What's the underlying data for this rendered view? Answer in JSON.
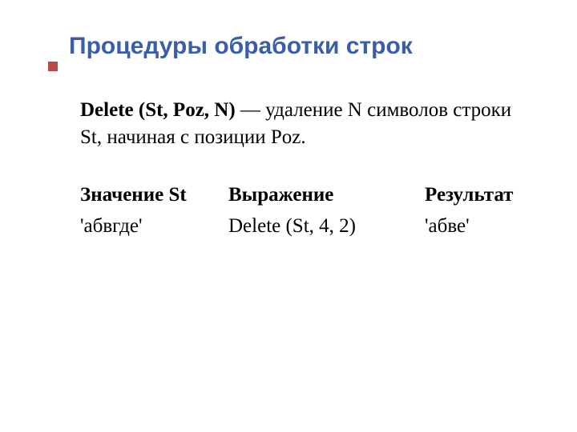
{
  "title": "Процедуры обработки строк",
  "desc": {
    "proc_name": "Delete (St, Poz, N)",
    "sep": " — ",
    "text": "удаление N символов строки St, начиная с позиции Poz."
  },
  "table": {
    "headers": {
      "c1": "Значение St",
      "c2": "Выражение",
      "c3": "Результат"
    },
    "row": {
      "c1": "'абвгде'",
      "c2": "Delete (St, 4, 2)",
      "c3": "'абве'"
    }
  }
}
